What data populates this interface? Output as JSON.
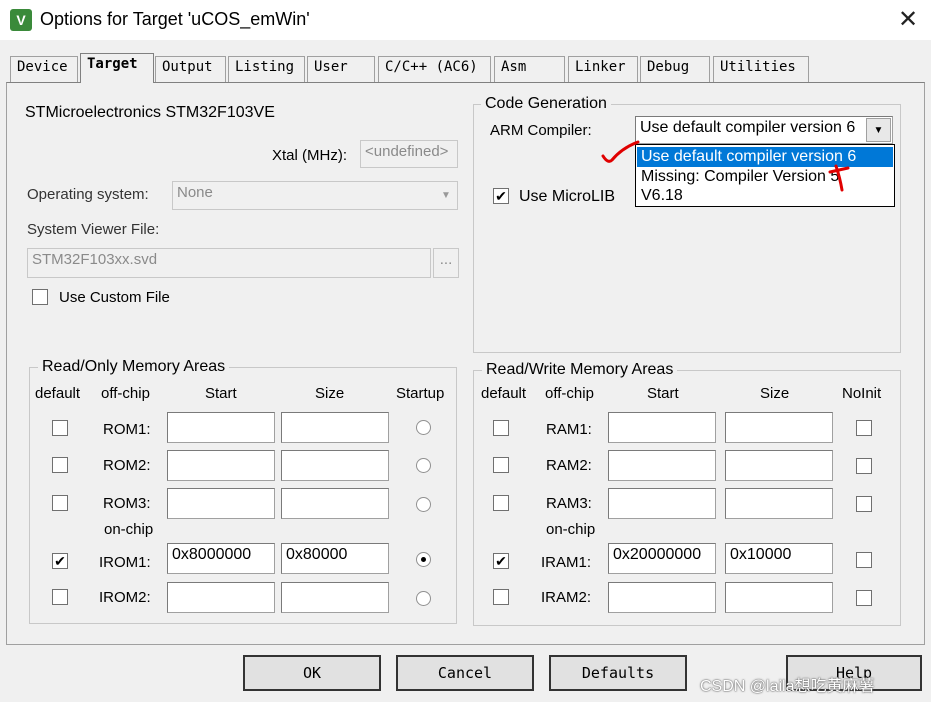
{
  "window": {
    "title": "Options for Target 'uCOS_emWin'",
    "icon_letter": "V",
    "close_glyph": "✕"
  },
  "tabs": [
    {
      "label": "Device"
    },
    {
      "label": "Target"
    },
    {
      "label": "Output"
    },
    {
      "label": "Listing"
    },
    {
      "label": "User"
    },
    {
      "label": "C/C++ (AC6)"
    },
    {
      "label": "Asm"
    },
    {
      "label": "Linker"
    },
    {
      "label": "Debug"
    },
    {
      "label": "Utilities"
    }
  ],
  "active_tab": "Target",
  "device": {
    "name": "STMicroelectronics STM32F103VE",
    "xtal_label": "Xtal (MHz):",
    "xtal_value": "<undefined>",
    "os_label": "Operating system:",
    "os_value": "None",
    "svd_label": "System Viewer File:",
    "svd_value": "STM32F103xx.svd",
    "svd_browse": "...",
    "custom_file_label": "Use Custom File",
    "custom_file_checked": false
  },
  "code_generation": {
    "title": "Code Generation",
    "arm_compiler_label": "ARM Compiler:",
    "arm_compiler_value": "Use default compiler version 6",
    "options": [
      "Use default compiler version 6",
      "Missing: Compiler Version 5",
      "V6.18"
    ],
    "selected_index": 0,
    "microlib_label": "Use MicroLIB",
    "microlib_checked": true
  },
  "ro_memory": {
    "title": "Read/Only Memory Areas",
    "headers": {
      "default": "default",
      "offchip": "off-chip",
      "start": "Start",
      "size": "Size",
      "startup": "Startup"
    },
    "onchip_label": "on-chip",
    "rows": [
      {
        "name": "ROM1:",
        "default": false,
        "start": "",
        "size": "",
        "startup": false
      },
      {
        "name": "ROM2:",
        "default": false,
        "start": "",
        "size": "",
        "startup": false
      },
      {
        "name": "ROM3:",
        "default": false,
        "start": "",
        "size": "",
        "startup": false
      },
      {
        "name": "IROM1:",
        "default": true,
        "start": "0x8000000",
        "size": "0x80000",
        "startup": true
      },
      {
        "name": "IROM2:",
        "default": false,
        "start": "",
        "size": "",
        "startup": false
      }
    ]
  },
  "rw_memory": {
    "title": "Read/Write Memory Areas",
    "headers": {
      "default": "default",
      "offchip": "off-chip",
      "start": "Start",
      "size": "Size",
      "noinit": "NoInit"
    },
    "onchip_label": "on-chip",
    "rows": [
      {
        "name": "RAM1:",
        "default": false,
        "start": "",
        "size": "",
        "noinit": false
      },
      {
        "name": "RAM2:",
        "default": false,
        "start": "",
        "size": "",
        "noinit": false
      },
      {
        "name": "RAM3:",
        "default": false,
        "start": "",
        "size": "",
        "noinit": false
      },
      {
        "name": "IRAM1:",
        "default": true,
        "start": "0x20000000",
        "size": "0x10000",
        "noinit": false
      },
      {
        "name": "IRAM2:",
        "default": false,
        "start": "",
        "size": "",
        "noinit": false
      }
    ]
  },
  "buttons": {
    "ok": "OK",
    "cancel": "Cancel",
    "defaults": "Defaults",
    "help": "Help"
  },
  "watermark": "CSDN @laila想吃黄麻薯",
  "annotations": {
    "check_color": "#e00000",
    "cross_color": "#e00000"
  },
  "colors": {
    "selection": "#0078d7",
    "dialog_bg": "#f0f0f0"
  }
}
